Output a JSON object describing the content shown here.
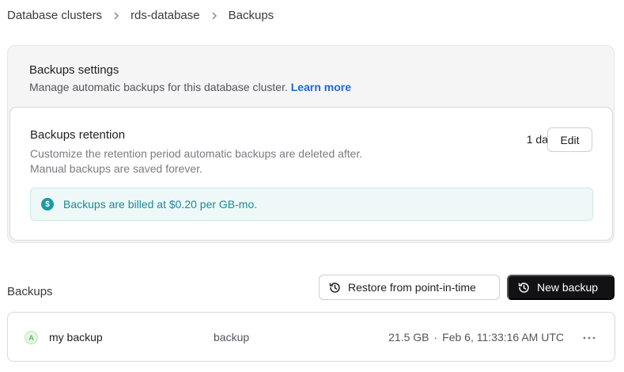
{
  "breadcrumb": {
    "items": [
      "Database clusters",
      "rds-database",
      "Backups"
    ]
  },
  "settings": {
    "title": "Backups settings",
    "description": "Manage automatic backups for this database cluster.",
    "learn_more": "Learn more"
  },
  "retention": {
    "title": "Backups retention",
    "desc_line1": "Customize the retention period automatic backups are deleted after.",
    "desc_line2": "Manual backups are saved forever.",
    "value": "1 day",
    "edit_label": "Edit"
  },
  "billing": {
    "icon": "dollar-circle-icon",
    "text": "Backups are billed at $0.20 per GB-mo."
  },
  "backups": {
    "section_label": "Backups",
    "restore_label": "Restore from point-in-time",
    "new_label": "New backup",
    "items": [
      {
        "avatar": "A",
        "name": "my backup",
        "type": "backup",
        "size": "21.5 GB",
        "separator": "·",
        "created": "Feb 6, 11:33:16 AM UTC"
      }
    ]
  },
  "colors": {
    "accent_link": "#1a6ad6",
    "billing_text": "#1b8a96",
    "primary_button": "#121214"
  }
}
